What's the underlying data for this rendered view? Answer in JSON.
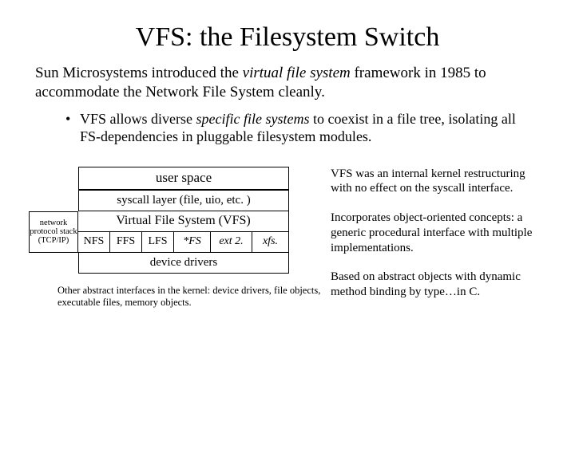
{
  "title": "VFS: the Filesystem Switch",
  "intro_pre": "Sun Microsystems introduced the ",
  "intro_italic": "virtual file system",
  "intro_post": " framework in 1985 to accommodate the Network File System cleanly.",
  "bullet_pre": "VFS allows diverse ",
  "bullet_italic": "specific file systems",
  "bullet_post": " to coexist in a file tree, isolating all FS-dependencies in pluggable filesystem modules.",
  "diagram": {
    "user_space": "user space",
    "syscall": "syscall layer (file, uio, etc. )",
    "net_stack": "network protocol stack (TCP/IP)",
    "vfs": "Virtual File System (VFS)",
    "fs": [
      "NFS",
      "FFS",
      "LFS",
      "*FS",
      "ext 2.",
      "xfs."
    ],
    "drivers": "device drivers"
  },
  "caption": "Other abstract interfaces in the kernel: device drivers, file objects, executable files, memory objects.",
  "notes": [
    "VFS was an internal kernel restructuring with no effect on the syscall interface.",
    "Incorporates object-oriented concepts: a generic procedural interface with multiple implementations.",
    "Based on abstract objects with dynamic method binding by type…in C."
  ]
}
